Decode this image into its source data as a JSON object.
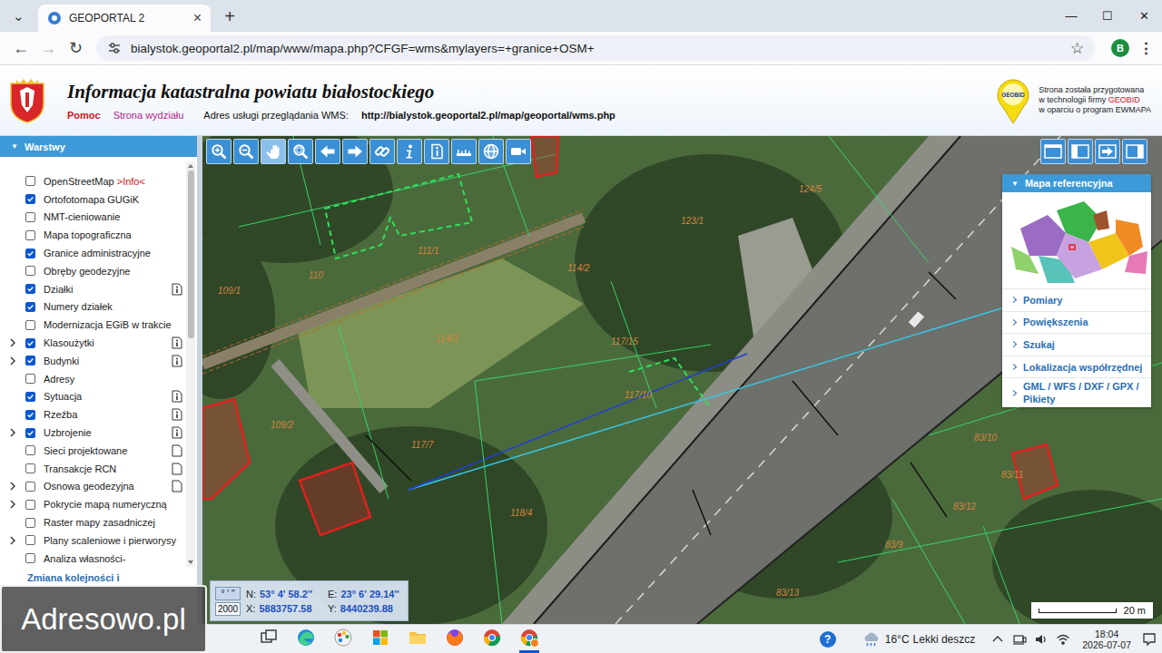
{
  "browser": {
    "tab_menu": "⌄",
    "tab": {
      "title": "GEOPORTAL 2",
      "close": "×",
      "selected": true
    },
    "new_tab": "+",
    "window_controls": [
      "—",
      "☐",
      "✕"
    ],
    "nav": [
      {
        "icon": "←",
        "disabled": false
      },
      {
        "icon": "→",
        "disabled": true
      },
      {
        "icon": "↻",
        "disabled": false
      }
    ],
    "url": "bialystok.geoportal2.pl/map/www/mapa.php?CFGF=wms&mylayers=+granice+OSM+",
    "bookmark": "☆",
    "profile": "B",
    "menu": "⋮"
  },
  "header": {
    "title": "Informacja katastralna powiatu białostockiego",
    "links": [
      {
        "label": "Pomoc",
        "kind": "help"
      },
      {
        "label": "Strona wydziału",
        "kind": "department"
      }
    ],
    "wms_label": "Adres usługi przeglądania WMS:",
    "wms_url": "http://bialystok.geoportal2.pl/map/geoportal/wms.php",
    "vendor": {
      "logo_text": "GEOBID",
      "lines": [
        {
          "text": "Strona została przygotowana"
        },
        {
          "text": "w technologii firmy ",
          "brand": "GEOBID"
        },
        {
          "text": "w oparciu o program EWMAPA"
        }
      ]
    }
  },
  "sidebar": {
    "title": "Warstwy",
    "toggle": "▼",
    "layers": [
      {
        "label": "OpenStreetMap",
        "link": ">Info<",
        "checked": false,
        "expandable": false,
        "icon": "none"
      },
      {
        "label": "Ortofotomapa GUGiK",
        "checked": true,
        "expandable": false,
        "icon": "none"
      },
      {
        "label": "NMT-cieniowanie",
        "checked": false,
        "expandable": false,
        "icon": "none"
      },
      {
        "label": "Mapa topograficzna",
        "checked": false,
        "expandable": false,
        "icon": "none"
      },
      {
        "label": "Granice administracyjne",
        "checked": true,
        "expandable": false,
        "icon": "none"
      },
      {
        "label": "Obręby geodezyjne",
        "checked": false,
        "expandable": false,
        "icon": "none"
      },
      {
        "label": "Działki",
        "checked": true,
        "expandable": false,
        "icon": "info"
      },
      {
        "label": "Numery działek",
        "checked": true,
        "expandable": false,
        "icon": "none"
      },
      {
        "label": "Modernizacja EGiB w trakcie",
        "checked": false,
        "expandable": false,
        "icon": "none"
      },
      {
        "label": "Klasoużytki",
        "checked": true,
        "expandable": true,
        "icon": "info"
      },
      {
        "label": "Budynki",
        "checked": true,
        "expandable": true,
        "icon": "info"
      },
      {
        "label": "Adresy",
        "checked": false,
        "expandable": false,
        "icon": "none"
      },
      {
        "label": "Sytuacja",
        "checked": true,
        "expandable": false,
        "icon": "info"
      },
      {
        "label": "Rzeźba",
        "checked": true,
        "expandable": false,
        "icon": "info"
      },
      {
        "label": "Uzbrojenie",
        "checked": true,
        "expandable": true,
        "icon": "info"
      },
      {
        "label": "Sieci projektowane",
        "checked": false,
        "expandable": false,
        "icon": "doc"
      },
      {
        "label": "Transakcje RCN",
        "checked": false,
        "expandable": false,
        "icon": "doc"
      },
      {
        "label": "Osnowa geodezyjna",
        "checked": false,
        "expandable": true,
        "icon": "doc"
      },
      {
        "label": "Pokrycie mapą numeryczną",
        "checked": false,
        "expandable": true,
        "icon": "none"
      },
      {
        "label": "Raster mapy zasadniczej",
        "checked": false,
        "expandable": false,
        "icon": "none"
      },
      {
        "label": "Plany scaleniowe i pierworysy",
        "checked": false,
        "expandable": true,
        "icon": "none"
      },
      {
        "label": "Analiza własności-",
        "checked": false,
        "expandable": false,
        "icon": "none"
      }
    ],
    "footer": "Zmiana kolejności i"
  },
  "map": {
    "tools": [
      {
        "kind": "zoom-in",
        "selected": false
      },
      {
        "kind": "zoom-out",
        "selected": false
      },
      {
        "kind": "pan",
        "selected": true
      },
      {
        "kind": "zoom-window",
        "selected": false
      },
      {
        "kind": "back",
        "selected": false
      },
      {
        "kind": "forward",
        "selected": false
      },
      {
        "kind": "link",
        "selected": false
      },
      {
        "kind": "info",
        "selected": false
      },
      {
        "kind": "info-doc",
        "selected": false
      },
      {
        "kind": "measure",
        "selected": false
      },
      {
        "kind": "globe",
        "selected": false
      },
      {
        "kind": "camera",
        "selected": false
      }
    ],
    "layout_tools": [
      {
        "kind": "full"
      },
      {
        "kind": "left-panel"
      },
      {
        "kind": "arrow"
      },
      {
        "kind": "right-panel"
      }
    ],
    "labels": [
      "124/5",
      "123/1",
      "111/1",
      "114/2",
      "110",
      "109/1",
      "114/3",
      "117/15",
      "117/10",
      "109/2",
      "117/7",
      "118/4",
      "83/10",
      "83/11",
      "83/12",
      "83/9",
      "83/13"
    ],
    "scale": "20 m",
    "coordinates": {
      "format_buttons": [
        {
          "label": "° ' \"",
          "selected": true
        },
        {
          "label": "2000",
          "selected": false
        }
      ],
      "rows": [
        {
          "label": "N:",
          "value": "53° 4' 58.2''"
        },
        {
          "label": "E:",
          "value": "23° 6' 29.14''"
        },
        {
          "label": "X:",
          "value": "5883757.58"
        },
        {
          "label": "Y:",
          "value": "8440239.88"
        }
      ]
    }
  },
  "reference_panel": {
    "title": "Mapa referencyjna",
    "toggle": "▼",
    "items": [
      "Pomiary",
      "Powiększenia",
      "Szukaj",
      "Lokalizacja współrzędnej",
      "GML / WFS / DXF / GPX / Pikiety"
    ]
  },
  "watermark": "Adresowo.pl",
  "taskbar": {
    "apps": [
      {
        "kind": "task-view",
        "active": false
      },
      {
        "kind": "edge",
        "active": false
      },
      {
        "kind": "paint",
        "active": false
      },
      {
        "kind": "store",
        "active": false
      },
      {
        "kind": "explorer",
        "active": false
      },
      {
        "kind": "firefox",
        "active": false
      },
      {
        "kind": "chrome",
        "active": false
      },
      {
        "kind": "chrome-app",
        "active": true
      }
    ],
    "help": "?",
    "weather": {
      "temperature": "16°C",
      "condition": "Lekki deszcz"
    },
    "tray": [
      {
        "kind": "chevron"
      },
      {
        "kind": "device"
      },
      {
        "kind": "volume"
      },
      {
        "kind": "wifi"
      }
    ],
    "clock": {
      "time": "18:04",
      "date": "2026-07-07"
    }
  }
}
